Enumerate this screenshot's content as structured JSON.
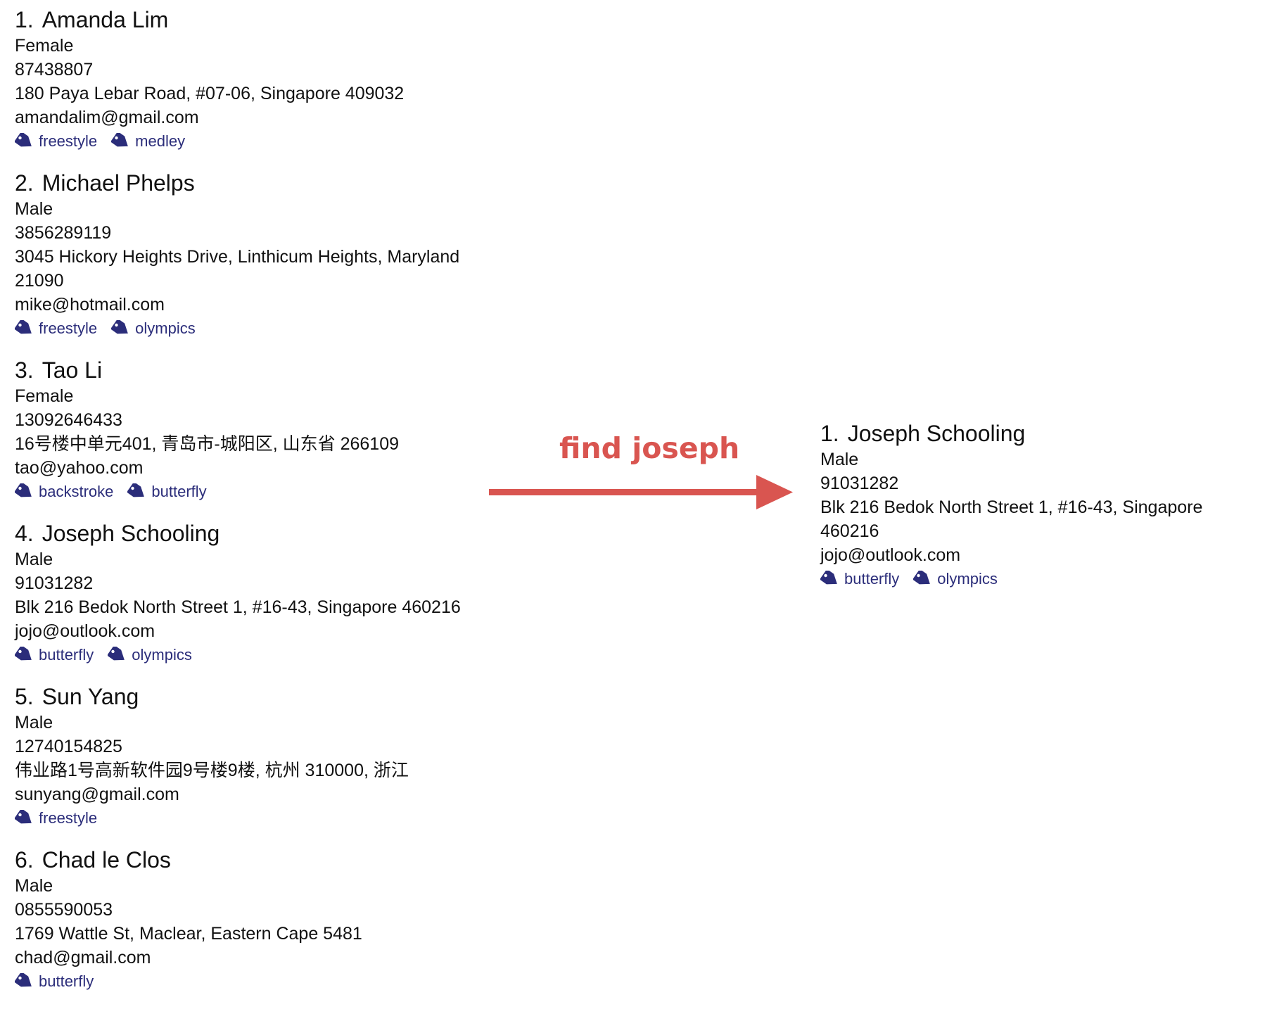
{
  "left_list": [
    {
      "index": "1.",
      "name": "Amanda Lim",
      "gender": "Female",
      "phone": "87438807",
      "address": "180 Paya Lebar Road, #07-06, Singapore 409032",
      "email": "amandalim@gmail.com",
      "tags": [
        "freestyle",
        "medley"
      ]
    },
    {
      "index": "2.",
      "name": "Michael Phelps",
      "gender": "Male",
      "phone": "3856289119",
      "address": "3045 Hickory Heights Drive, Linthicum Heights, Maryland 21090",
      "email": "mike@hotmail.com",
      "tags": [
        "freestyle",
        "olympics"
      ]
    },
    {
      "index": "3.",
      "name": "Tao Li",
      "gender": "Female",
      "phone": "13092646433",
      "address": "16号楼中单元401, 青岛市-城阳区, 山东省 266109",
      "email": "tao@yahoo.com",
      "tags": [
        "backstroke",
        "butterfly"
      ]
    },
    {
      "index": "4.",
      "name": "Joseph Schooling",
      "gender": "Male",
      "phone": "91031282",
      "address": "Blk 216 Bedok North Street 1, #16-43, Singapore 460216",
      "email": "jojo@outlook.com",
      "tags": [
        "butterfly",
        "olympics"
      ]
    },
    {
      "index": "5.",
      "name": "Sun Yang",
      "gender": "Male",
      "phone": "12740154825",
      "address": "伟业路1号高新软件园9号楼9楼, 杭州 310000, 浙江",
      "email": "sunyang@gmail.com",
      "tags": [
        "freestyle"
      ]
    },
    {
      "index": "6.",
      "name": "Chad le Clos",
      "gender": "Male",
      "phone": "0855590053",
      "address": "1769 Wattle St, Maclear, Eastern Cape 5481",
      "email": "chad@gmail.com",
      "tags": [
        "butterfly"
      ]
    }
  ],
  "annotation": {
    "command": "find joseph",
    "color": "#d95550"
  },
  "right_list": [
    {
      "index": "1.",
      "name": "Joseph Schooling",
      "gender": "Male",
      "phone": "91031282",
      "address": "Blk 216 Bedok North Street 1, #16-43, Singapore 460216",
      "email": "jojo@outlook.com",
      "tags": [
        "butterfly",
        "olympics"
      ]
    }
  ],
  "colors": {
    "tag": "#2b2d7a",
    "text": "#111111"
  }
}
